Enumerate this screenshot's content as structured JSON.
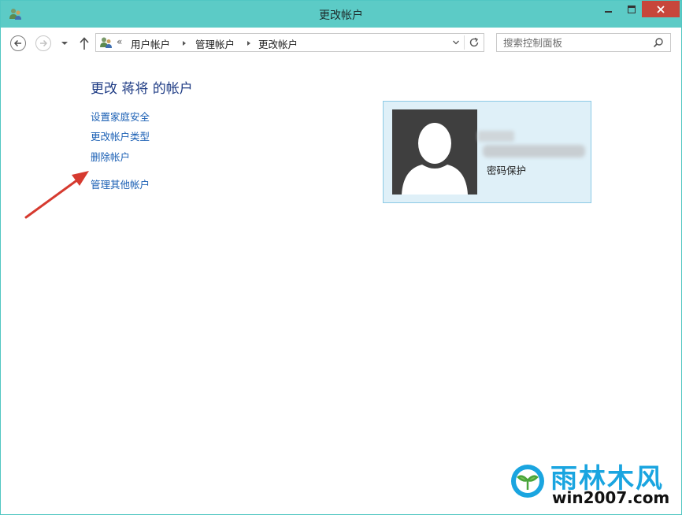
{
  "window": {
    "title": "更改帐户"
  },
  "navigation": {
    "breadcrumb_overflow": "«",
    "breadcrumbs": [
      "用户帐户",
      "管理帐户",
      "更改帐户"
    ],
    "search_placeholder": "搜索控制面板"
  },
  "main": {
    "heading": "更改 蒋将 的帐户",
    "tasks": [
      {
        "label": "设置家庭安全"
      },
      {
        "label": "更改帐户类型"
      },
      {
        "label": "删除帐户"
      },
      {
        "label": "管理其他帐户"
      }
    ],
    "account": {
      "status": "密码保护"
    }
  },
  "watermark": {
    "brand": "雨林木风",
    "site": "win2007.com"
  },
  "colors": {
    "titlebar": "#5ccbc6",
    "close_button": "#c7463b",
    "link": "#1a5fb4",
    "heading": "#1e3b84",
    "card_bg": "#dff0f8",
    "card_border": "#8ccae6",
    "annotation_arrow": "#d63a2f"
  },
  "icons": {
    "title": "users-icon",
    "back": "back-arrow-icon",
    "forward": "forward-arrow-icon",
    "up": "up-arrow-icon",
    "refresh": "refresh-icon",
    "search": "search-icon"
  }
}
